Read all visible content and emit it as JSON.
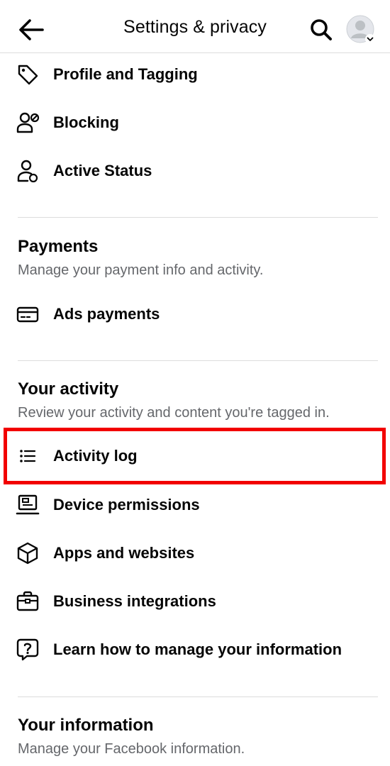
{
  "header": {
    "title": "Settings & privacy"
  },
  "top_items": [
    {
      "label": "Profile and Tagging",
      "icon": "tag-icon"
    },
    {
      "label": "Blocking",
      "icon": "blocked-user-icon"
    },
    {
      "label": "Active Status",
      "icon": "active-status-icon"
    }
  ],
  "payments": {
    "title": "Payments",
    "subtitle": "Manage your payment info and activity.",
    "items": [
      {
        "label": "Ads payments",
        "icon": "credit-card-icon"
      }
    ]
  },
  "your_activity": {
    "title": "Your activity",
    "subtitle": "Review your activity and content you're tagged in.",
    "items": [
      {
        "label": "Activity log",
        "icon": "list-icon"
      },
      {
        "label": "Device permissions",
        "icon": "device-icon"
      },
      {
        "label": "Apps and websites",
        "icon": "cube-icon"
      },
      {
        "label": "Business integrations",
        "icon": "briefcase-icon"
      },
      {
        "label": "Learn how to manage your information",
        "icon": "question-chat-icon"
      }
    ]
  },
  "your_information": {
    "title": "Your information",
    "subtitle": "Manage your Facebook information."
  },
  "colors": {
    "highlight": "#f20000",
    "subtitle": "#65676b",
    "divider": "#dcdcdc"
  }
}
